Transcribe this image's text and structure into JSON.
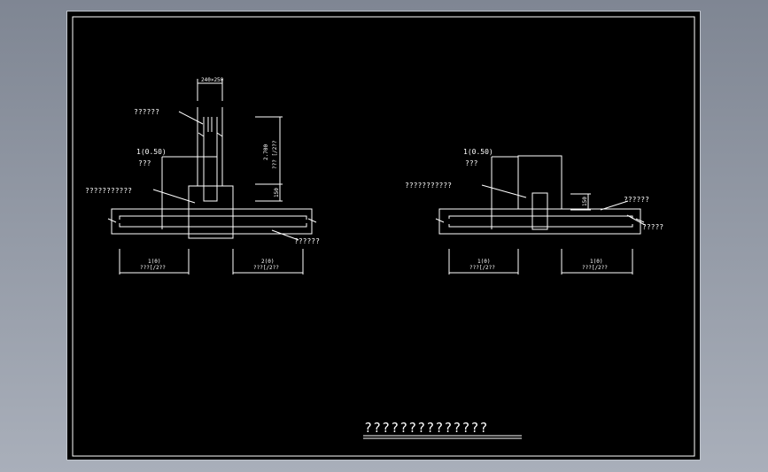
{
  "drawing": {
    "title": "??????????????",
    "left_detail": {
      "top_dim": "240×250",
      "label_top": "??????",
      "level_value": "1(0.50)",
      "level_unit": "???",
      "label_concrete": "???????????",
      "label_bottom_right": "??????",
      "vertical_dim_value": "2.700",
      "vertical_dim_note": "??? [/2??",
      "small_dim": "150",
      "dim_left_value": "1(0)",
      "dim_left_note": "???[/2??",
      "dim_right_value": "2(0)",
      "dim_right_note": "???[/2??"
    },
    "right_detail": {
      "level_value": "1(0.50)",
      "level_unit": "???",
      "label_left": "???????????",
      "label_right_1": "??????",
      "label_right_2": "?????",
      "small_dim": "150",
      "dim_left_value": "1(0)",
      "dim_left_note": "???[/2??",
      "dim_right_value": "1(0)",
      "dim_right_note": "???[/2??"
    }
  },
  "colors": {
    "canvas": "#000000",
    "line": "#ffffff",
    "background": "#8e95a0"
  }
}
